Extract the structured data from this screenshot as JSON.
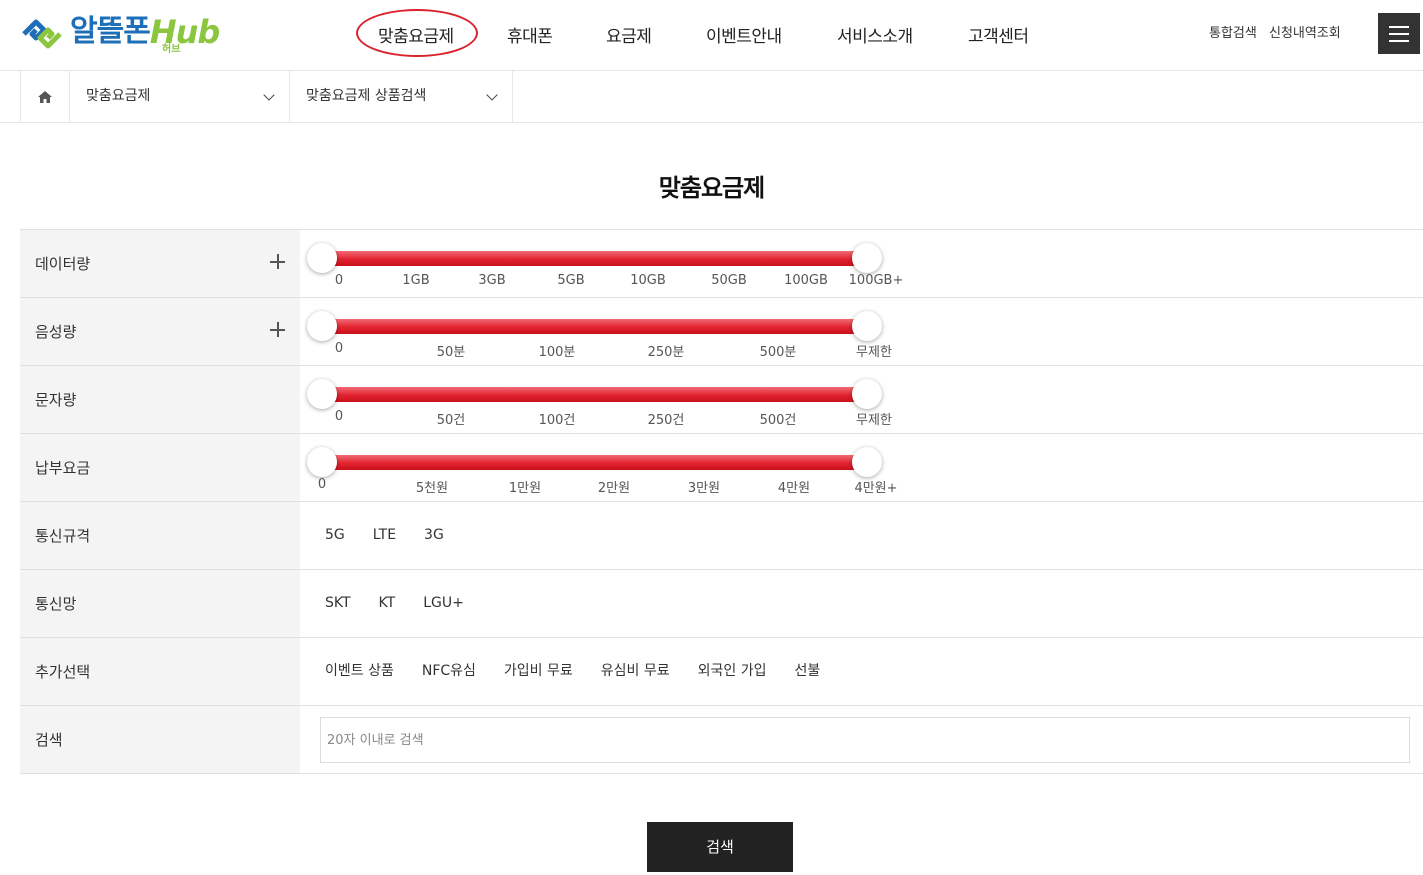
{
  "header": {
    "logo_main": "알뜰폰",
    "logo_hub": "Hub",
    "logo_sub": "허브",
    "nav": [
      "맞춤요금제",
      "휴대폰",
      "요금제",
      "이벤트안내",
      "서비스소개",
      "고객센터"
    ],
    "util": [
      "통합검색",
      "신청내역조회"
    ],
    "menu_icon": "hamburger-menu-icon"
  },
  "breadcrumb": {
    "home_icon": "home-icon",
    "level1": "맞춤요금제",
    "level2": "맞춤요금제 상품검색"
  },
  "title": "맞춤요금제",
  "filters": {
    "data": {
      "label": "데이터량",
      "ticks": [
        "0",
        "1GB",
        "3GB",
        "5GB",
        "10GB",
        "50GB",
        "100GB",
        "100GB+"
      ],
      "range": [
        "0",
        "100GB+"
      ]
    },
    "voice": {
      "label": "음성량",
      "ticks": [
        "0",
        "50분",
        "100분",
        "250분",
        "500분",
        "무제한"
      ],
      "range": [
        "0",
        "무제한"
      ]
    },
    "sms": {
      "label": "문자량",
      "ticks": [
        "0",
        "50건",
        "100건",
        "250건",
        "500건",
        "무제한"
      ],
      "range": [
        "0",
        "무제한"
      ]
    },
    "fee": {
      "label": "납부요금",
      "ticks": [
        "0",
        "5천원",
        "1만원",
        "2만원",
        "3만원",
        "4만원",
        "4만원+"
      ],
      "range": [
        "0",
        "4만원+"
      ]
    },
    "network_type": {
      "label": "통신규격",
      "options": [
        "5G",
        "LTE",
        "3G"
      ]
    },
    "carrier": {
      "label": "통신망",
      "options": [
        "SKT",
        "KT",
        "LGU+"
      ]
    },
    "extra": {
      "label": "추가선택",
      "options": [
        "이벤트 상품",
        "NFC유심",
        "가입비 무료",
        "유심비 무료",
        "외국인 가입",
        "선불"
      ]
    },
    "search": {
      "label": "검색",
      "placeholder": "20자 이내로 검색"
    }
  },
  "submit_label": "검색",
  "colors": {
    "accent": "#e2232f",
    "logo_blue": "#1d6fb8",
    "logo_green": "#8cc63f",
    "button_dark": "#222222"
  }
}
